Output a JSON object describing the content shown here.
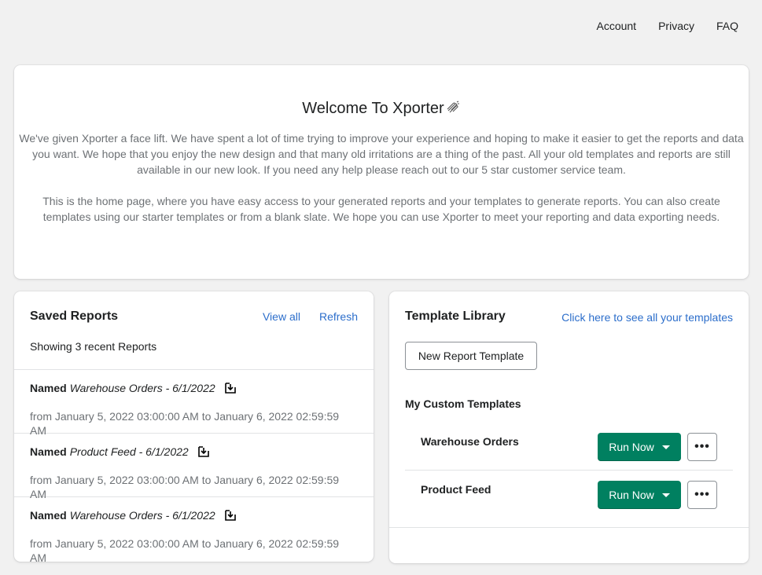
{
  "nav": {
    "account": "Account",
    "privacy": "Privacy",
    "faq": "FAQ"
  },
  "welcome": {
    "title": "Welcome To Xporter",
    "para1": "We've given Xporter a face lift. We have spent a lot of time trying to improve your experience and hoping to make it easier to get the reports and data you want. We hope that you enjoy the new design and that many old irritations are a thing of the past. All your old templates and reports are still available in our new look. If you need any help please reach out to our 5 star customer service team.",
    "para2": "This is the home page, where you have easy access to your generated reports and your templates to generate reports. You can also create templates using our starter templates or from a blank slate. We hope you can use Xporter to meet your reporting and data exporting needs."
  },
  "saved_reports": {
    "title": "Saved Reports",
    "view_all": "View all",
    "refresh": "Refresh",
    "showing": "Showing 3 recent Reports",
    "items": [
      {
        "prefix": "Named",
        "name": "Warehouse Orders - 6/1/2022",
        "range": "from January 5, 2022 03:00:00 AM to January 6, 2022 02:59:59 AM"
      },
      {
        "prefix": "Named",
        "name": "Product Feed - 6/1/2022",
        "range": "from January 5, 2022 03:00:00 AM to January 6, 2022 02:59:59 AM"
      },
      {
        "prefix": "Named",
        "name": "Warehouse Orders - 6/1/2022",
        "range": "from January 5, 2022 03:00:00 AM to January 6, 2022 02:59:59 AM"
      }
    ]
  },
  "template_library": {
    "title": "Template Library",
    "see_all": "Click here to see all your templates",
    "new_button": "New Report Template",
    "custom_title": "My Custom Templates",
    "templates": [
      {
        "name": "Warehouse Orders",
        "run_label": "Run Now"
      },
      {
        "name": "Product Feed",
        "run_label": "Run Now"
      }
    ],
    "more_label": "•••"
  },
  "colors": {
    "primary": "#008060",
    "link": "#2c6ecb",
    "background": "#f1f1f1"
  }
}
